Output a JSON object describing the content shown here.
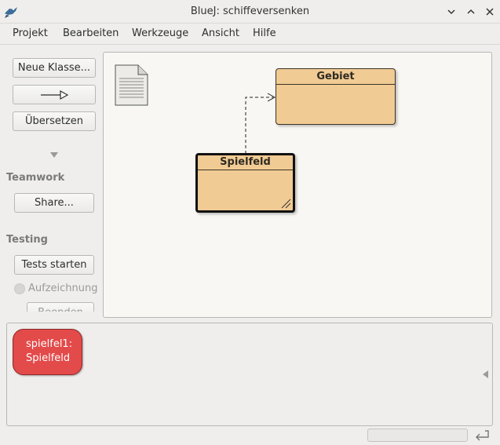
{
  "window": {
    "title": "BlueJ: schiffeversenken",
    "app_icon": "bluej-bird-icon",
    "controls": [
      "minimize-icon",
      "maximize-icon",
      "close-icon"
    ]
  },
  "menubar": {
    "items": [
      "Projekt",
      "Bearbeiten",
      "Werkzeuge",
      "Ansicht",
      "Hilfe"
    ]
  },
  "sidebar": {
    "new_class_label": "Neue Klasse...",
    "arrow_tool_icon": "inheritance-arrow-icon",
    "compile_label": "Übersetzen",
    "collapse_icon": "triangle-down-icon",
    "teamwork_heading": "Teamwork",
    "share_label": "Share...",
    "testing_heading": "Testing",
    "run_tests_label": "Tests starten",
    "recording_label": "Aufzeichnung",
    "end_label": "Beenden"
  },
  "diagram": {
    "readme_icon": "readme-document-icon",
    "classes": [
      {
        "name": "Gebiet",
        "selected": false
      },
      {
        "name": "Spielfeld",
        "selected": true
      }
    ],
    "relation": {
      "from": "Spielfeld",
      "to": "Gebiet",
      "kind": "uses"
    }
  },
  "object_bench": {
    "objects": [
      {
        "line1": "spielfel1:",
        "line2": "Spielfeld",
        "color": "#e34a4a"
      }
    ],
    "scroll_arrow_icon": "triangle-left-icon"
  },
  "statusbar": {
    "terminal_icon": "return-arrow-icon"
  },
  "colors": {
    "class_fill": "#f1cb94",
    "object_fill": "#e34a4a",
    "canvas_bg": "#f8f7f3"
  }
}
